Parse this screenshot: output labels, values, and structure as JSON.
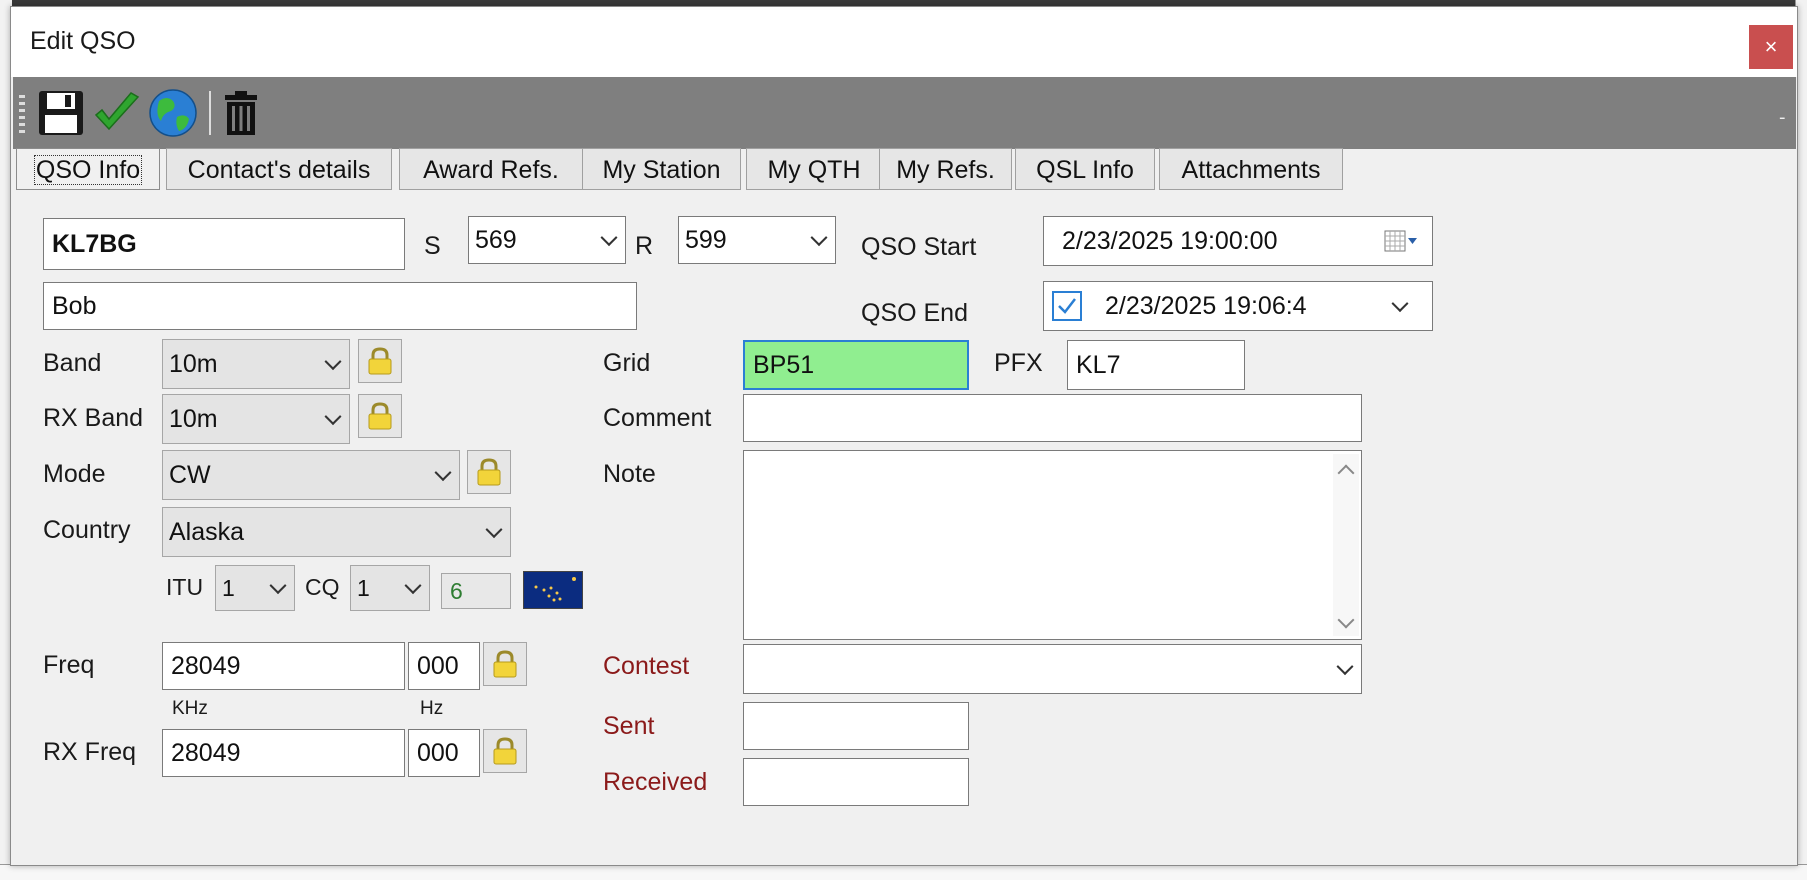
{
  "window": {
    "title": "Edit QSO",
    "close": "×",
    "toolbar_collapse": "-"
  },
  "toolbar": {
    "icons": [
      "save-icon",
      "check-icon",
      "globe-icon",
      "trash-icon"
    ]
  },
  "tabs": [
    {
      "label": "QSO Info",
      "active": true
    },
    {
      "label": "Contact's details"
    },
    {
      "label": "Award Refs."
    },
    {
      "label": "My Station"
    },
    {
      "label": "My QTH"
    },
    {
      "label": "My Refs."
    },
    {
      "label": "QSL Info"
    },
    {
      "label": "Attachments"
    }
  ],
  "qso": {
    "call": "KL7BG",
    "name": "Bob",
    "s_label": "S",
    "s_value": "569",
    "r_label": "R",
    "r_value": "599",
    "start_label": "QSO Start",
    "start_value": "2/23/2025 19:00:00",
    "end_label": "QSO End",
    "end_value": "2/23/2025 19:06:4",
    "end_checked": true
  },
  "left": {
    "band_label": "Band",
    "band": "10m",
    "rxband_label": "RX Band",
    "rxband": "10m",
    "mode_label": "Mode",
    "mode": "CW",
    "country_label": "Country",
    "country": "Alaska",
    "itu_label": "ITU",
    "itu": "1",
    "cq_label": "CQ",
    "cq": "1",
    "zone": "6",
    "freq_label": "Freq",
    "freq": "28049",
    "freq_hz": "000",
    "khz_label": "KHz",
    "hz_label": "Hz",
    "rxfreq_label": "RX Freq",
    "rxfreq": "28049",
    "rxfreq_hz": "000"
  },
  "right": {
    "grid_label": "Grid",
    "grid": "BP51",
    "pfx_label": "PFX",
    "pfx": "KL7",
    "comment_label": "Comment",
    "comment": "",
    "note_label": "Note",
    "note": "",
    "contest_label": "Contest",
    "contest": "",
    "sent_label": "Sent",
    "sent": "",
    "received_label": "Received",
    "received": ""
  },
  "colors": {
    "grid_ok": "#90ee90",
    "contest_label": "#8b1a1a",
    "close": "#c94f4f"
  }
}
